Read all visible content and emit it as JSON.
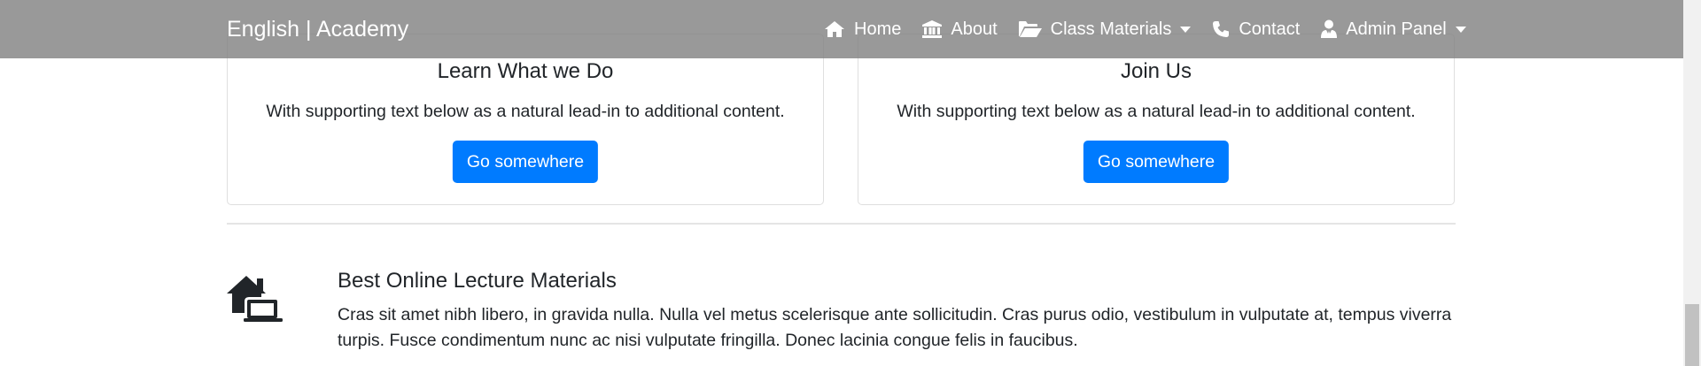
{
  "navbar": {
    "brand": "English | Academy",
    "items": [
      {
        "label": "Home",
        "icon": "home-icon"
      },
      {
        "label": "About",
        "icon": "bank-icon"
      },
      {
        "label": "Class Materials",
        "icon": "folder-open-icon",
        "dropdown": true
      },
      {
        "label": "Contact",
        "icon": "phone-icon"
      },
      {
        "label": "Admin Panel",
        "icon": "user-tie-icon",
        "dropdown": true
      }
    ]
  },
  "cards": [
    {
      "title": "Learn What we Do",
      "text": "With supporting text below as a natural lead-in to additional content.",
      "button": "Go somewhere"
    },
    {
      "title": "Join Us",
      "text": "With supporting text below as a natural lead-in to additional content.",
      "button": "Go somewhere"
    }
  ],
  "feature": {
    "icon": "laptop-house-icon",
    "title": "Best Online Lecture Materials",
    "text": "Cras sit amet nibh libero, in gravida nulla. Nulla vel metus scelerisque ante sollicitudin. Cras purus odio, vestibulum in vulputate at, tempus viverra turpis. Fusce condimentum nunc ac nisi vulputate fringilla. Donec lacinia congue felis in faucibus."
  },
  "colors": {
    "accent": "#007bff",
    "navbar_bg": "#8f8f8f",
    "text": "#212529"
  }
}
